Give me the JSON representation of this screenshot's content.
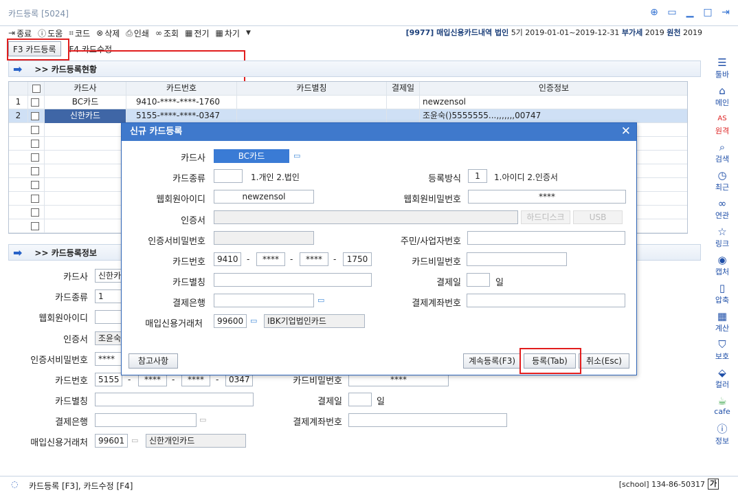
{
  "window": {
    "title": "카드등록 [5024]"
  },
  "toolbar": {
    "items": [
      {
        "label": "종료"
      },
      {
        "label": "도움"
      },
      {
        "label": "코드"
      },
      {
        "label": "삭제"
      },
      {
        "label": "인쇄"
      },
      {
        "label": "조회"
      },
      {
        "label": "전기"
      },
      {
        "label": "차기"
      }
    ],
    "company": "[9977] 매입신용카드내역 법인",
    "period": "5기 2019-01-01~2019-12-31",
    "vat": "부가세",
    "vat_year": "2019",
    "tax": "원천",
    "tax_year": "2019"
  },
  "tabs": {
    "register": "F3 카드등록",
    "edit": "F4 카드수정"
  },
  "sidebar": [
    {
      "label": "툴바"
    },
    {
      "label": "메인"
    },
    {
      "label": "원격"
    },
    {
      "label": "검색"
    },
    {
      "label": "최근"
    },
    {
      "label": "연관"
    },
    {
      "label": "링크"
    },
    {
      "label": "캡처"
    },
    {
      "label": "압축"
    },
    {
      "label": "계산"
    },
    {
      "label": "보호"
    },
    {
      "label": "컬러"
    },
    {
      "label": "cafe"
    },
    {
      "label": "정보"
    }
  ],
  "status_section": {
    "title": ">> 카드등록현황"
  },
  "grid": {
    "headers": [
      "카드사",
      "카드번호",
      "카드별칭",
      "결제일",
      "인증정보"
    ],
    "rows": [
      {
        "no": "1",
        "company": "BC카드",
        "number": "9410-****-****-1760",
        "alias": "",
        "payday": "",
        "auth": "newzensol"
      },
      {
        "no": "2",
        "company": "신한카드",
        "number": "5155-****-****-0347",
        "alias": "",
        "payday": "",
        "auth": "조윤숙()5555555...,,,,,,,00747"
      }
    ]
  },
  "info_section": {
    "title": ">> 카드등록정보",
    "labels": {
      "company": "카드사",
      "type": "카드종류",
      "webid": "웹회원아이디",
      "cert": "인증서",
      "certpw": "인증서비밀번호",
      "number": "카드번호",
      "alias": "카드별칭",
      "bank": "결제은행",
      "vendor": "매입신용거래처",
      "cardpw": "카드비밀번호",
      "payday": "결제일",
      "account": "결제계좌번호",
      "day": "일"
    },
    "values": {
      "company": "신한카드",
      "type": "1",
      "cert": "조윤숙",
      "certpw": "****",
      "num1": "5155",
      "num2": "****",
      "num3": "****",
      "num4": "0347",
      "cardpw": "****",
      "vendor_code": "99601",
      "vendor_name": "신한개인카드"
    }
  },
  "dialog": {
    "title": "신규 카드등록",
    "labels": {
      "company": "카드사",
      "type": "카드종류",
      "type_hint": "1.개인 2.법인",
      "method": "등록방식",
      "method_hint": "1.아이디 2.인증서",
      "webid": "웹회원아이디",
      "webpw": "웹회원비밀번호",
      "cert": "인증서",
      "certpw": "인증서비밀번호",
      "rrn": "주민/사업자번호",
      "number": "카드번호",
      "cardpw": "카드비밀번호",
      "alias": "카드별칭",
      "payday": "결제일",
      "day": "일",
      "bank": "결제은행",
      "account": "결제계좌번호",
      "vendor": "매입신용거래처"
    },
    "values": {
      "company": "BC카드",
      "type": "",
      "method": "1",
      "webid": "newzensol",
      "webpw": "****",
      "num1": "9410",
      "num2": "****",
      "num3": "****",
      "num4": "1750",
      "vendor_code": "99600",
      "vendor_name": "IBK기업법인카드"
    },
    "buttons": {
      "harddisk": "하드디스크",
      "usb": "USB",
      "notes": "참고사항",
      "continue": "계속등록(F3)",
      "register": "등록(Tab)",
      "cancel": "취소(Esc)"
    }
  },
  "statusbar": {
    "hint": "카드등록 [F3], 카드수정 [F4]",
    "user": "[school] 134-86-50317",
    "ime": "가"
  }
}
